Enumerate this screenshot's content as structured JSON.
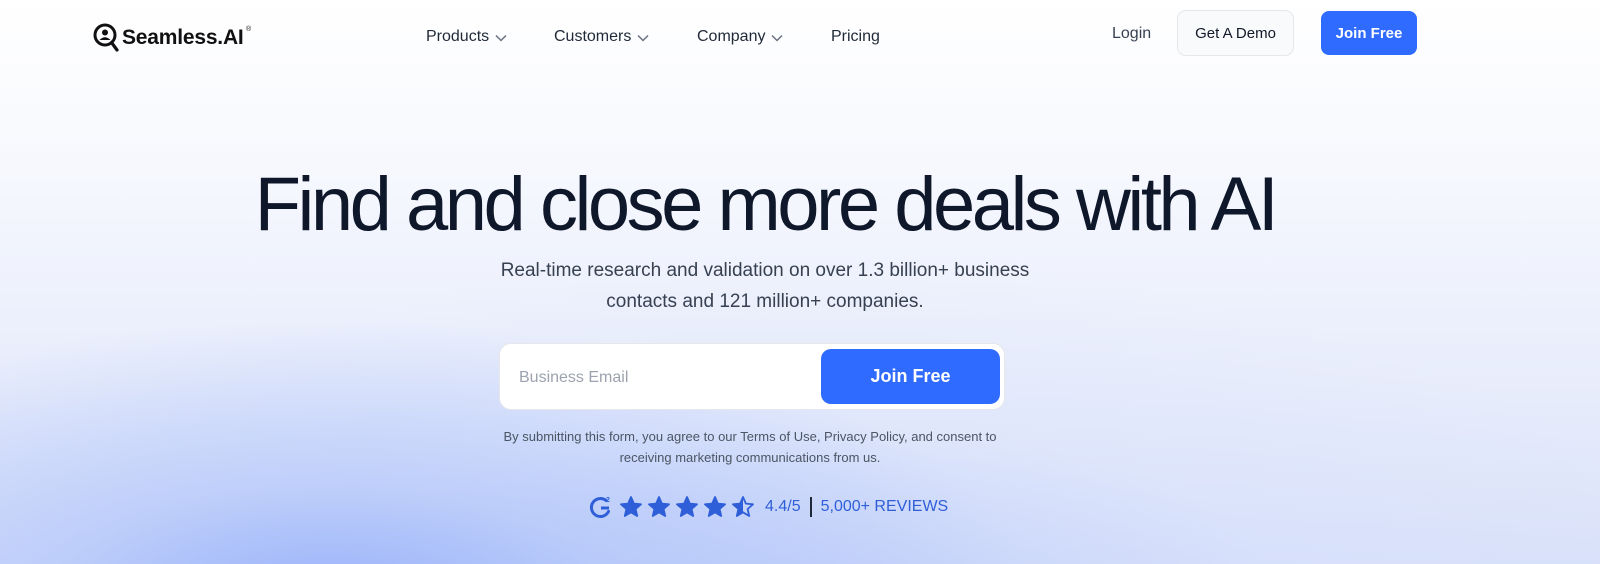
{
  "header": {
    "logo_text": "Seamless.AI",
    "logo_mark": "®",
    "nav": [
      {
        "label": "Products",
        "dropdown": true
      },
      {
        "label": "Customers",
        "dropdown": true
      },
      {
        "label": "Company",
        "dropdown": true
      },
      {
        "label": "Pricing",
        "dropdown": false
      }
    ],
    "login_label": "Login",
    "demo_label": "Get A Demo",
    "join_label": "Join Free"
  },
  "hero": {
    "title": "Find and close more deals with AI",
    "subtitle_line1": "Real-time research and validation on over 1.3 billion+ business",
    "subtitle_line2": "contacts and 121 million+ companies."
  },
  "signup": {
    "email_placeholder": "Business Email",
    "submit_label": "Join Free"
  },
  "disclaimer": {
    "prefix": "By submitting this form, you agree to our ",
    "terms": "Terms of Use",
    "comma": ", ",
    "privacy": "Privacy Policy",
    "suffix_line1": ", and consent to",
    "line2": "receiving marketing communications from us."
  },
  "rating": {
    "source_icon": "g2-icon",
    "stars": 4.5,
    "max_stars": 5,
    "score": "4.4/5",
    "separator": "|",
    "reviews": "5,000+ REVIEWS"
  },
  "colors": {
    "accent": "#2f6bff",
    "rating_blue": "#2f5fd8",
    "title": "#0f172a"
  }
}
